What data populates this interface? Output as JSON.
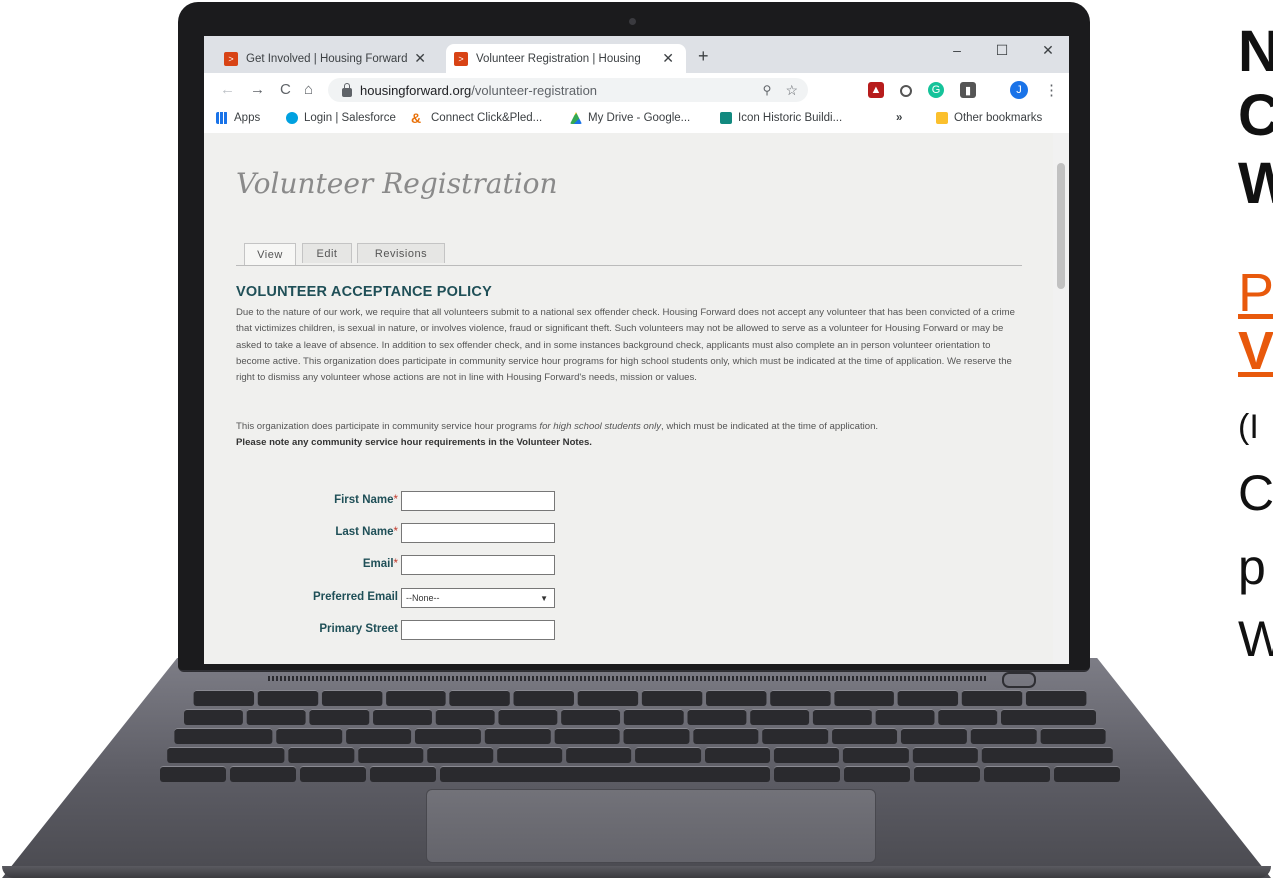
{
  "browser": {
    "tabs": [
      {
        "label": "Get Involved | Housing Forward",
        "active": false
      },
      {
        "label": "Volunteer Registration | Housing",
        "active": true
      }
    ],
    "new_tab_icon": "+",
    "window_controls": {
      "minimize": "–",
      "maximize": "☐",
      "close": "✕"
    },
    "url_host": "housingforward.org",
    "url_path": "/volunteer-registration",
    "bookmarks": [
      {
        "label": "Apps",
        "icon": "apps-grid-icon",
        "color": "#1a73e8"
      },
      {
        "label": "Login | Salesforce",
        "icon": "salesforce-icon",
        "color": "#00a1e0"
      },
      {
        "label": "Connect Click&Pled...",
        "icon": "clickpledge-icon",
        "color": "#e8710a"
      },
      {
        "label": "My Drive - Google...",
        "icon": "drive-icon",
        "color": "#fbbc04"
      },
      {
        "label": "Icon Historic Buildi...",
        "icon": "icon-site-icon",
        "color": "#12897f"
      }
    ],
    "bookmarks_overflow": "»",
    "other_bookmarks": "Other bookmarks",
    "profile_initial": "J"
  },
  "page": {
    "title": "Volunteer Registration",
    "tabs": [
      "View",
      "Edit",
      "Revisions"
    ],
    "policy_heading": "VOLUNTEER ACCEPTANCE POLICY",
    "policy_text": "Due to the nature of our work, we require that all volunteers submit to a national sex offender check. Housing Forward does not accept any volunteer that has been convicted of a crime that victimizes children, is sexual in nature, or involves violence, fraud or significant theft. Such volunteers may not be allowed to serve as a volunteer for Housing Forward or may be asked to take a leave of absence. In addition to sex offender check, and in some instances background check, applicants must also complete an in person volunteer orientation to become active. This organization does participate in community service hour programs for high school students only, which must be indicated at the time of application. We reserve the right to dismiss any volunteer whose actions are not in line with Housing Forward's needs, mission or values.",
    "service_note_start": "This organization does participate in community service hour programs ",
    "service_note_italic": "for high school students only",
    "service_note_end": ", which must be indicated at the time of application.",
    "service_note_bold": "Please note any community service hour requirements in the Volunteer Notes.",
    "form": {
      "first_name": "First Name",
      "last_name": "Last Name",
      "email": "Email",
      "preferred_email": "Preferred Email",
      "preferred_email_value": "--None--",
      "primary_street": "Primary Street",
      "required_mark": "*"
    }
  },
  "side_text": {
    "line1": "N",
    "line2": "C",
    "line3": "W",
    "line4": "P",
    "line5": "V",
    "line6": "(I",
    "line7": "C",
    "line8": "p",
    "line9": "W"
  },
  "colors": {
    "accent_orange": "#e8590c",
    "heading_teal": "#1f4f57"
  }
}
